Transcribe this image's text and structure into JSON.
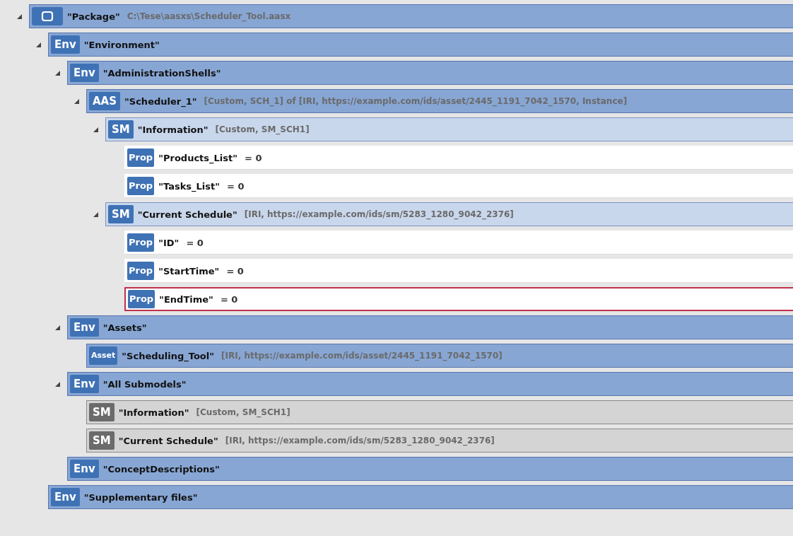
{
  "tree": [
    {
      "kind": "package",
      "name": "\"Package\"",
      "info": "C:\\Tese\\aasxs\\Scheduler_Tool.aasx",
      "expanded": true,
      "selected": false,
      "children": [
        {
          "kind": "env",
          "badge": "Env",
          "name": "\"Environment\"",
          "expanded": true,
          "selected": false,
          "children": [
            {
              "kind": "env",
              "badge": "Env",
              "name": "\"AdministrationShells\"",
              "expanded": true,
              "selected": false,
              "children": [
                {
                  "kind": "aas",
                  "badge": "AAS",
                  "name": "\"Scheduler_1\"",
                  "info": "[Custom, SCH_1] of [IRI, https://example.com/ids/asset/2445_1191_7042_1570, Instance]",
                  "expanded": true,
                  "selected": false,
                  "children": [
                    {
                      "kind": "sm",
                      "badge": "SM",
                      "name": "\"Information\"",
                      "info": "[Custom, SM_SCH1]",
                      "expanded": true,
                      "selected": false,
                      "children": [
                        {
                          "kind": "prop",
                          "badge": "Prop",
                          "name": "\"Products_List\"",
                          "value": "= 0",
                          "selected": false
                        },
                        {
                          "kind": "prop",
                          "badge": "Prop",
                          "name": "\"Tasks_List\"",
                          "value": "= 0",
                          "selected": false
                        }
                      ]
                    },
                    {
                      "kind": "sm",
                      "badge": "SM",
                      "name": "\"Current Schedule\"",
                      "info": "[IRI, https://example.com/ids/sm/5283_1280_9042_2376]",
                      "expanded": true,
                      "selected": false,
                      "children": [
                        {
                          "kind": "prop",
                          "badge": "Prop",
                          "name": "\"ID\"",
                          "value": "= 0",
                          "selected": false
                        },
                        {
                          "kind": "prop",
                          "badge": "Prop",
                          "name": "\"StartTime\"",
                          "value": "= 0",
                          "selected": false
                        },
                        {
                          "kind": "prop",
                          "badge": "Prop",
                          "name": "\"EndTime\"",
                          "value": "= 0",
                          "selected": true
                        }
                      ]
                    }
                  ]
                }
              ]
            },
            {
              "kind": "env",
              "badge": "Env",
              "name": "\"Assets\"",
              "expanded": true,
              "selected": false,
              "children": [
                {
                  "kind": "asset",
                  "badge": "Asset",
                  "name": "\"Scheduling_Tool\"",
                  "info": "[IRI, https://example.com/ids/asset/2445_1191_7042_1570]",
                  "selected": false
                }
              ]
            },
            {
              "kind": "env",
              "badge": "Env",
              "name": "\"All Submodels\"",
              "expanded": true,
              "selected": false,
              "children": [
                {
                  "kind": "smref",
                  "badge": "SM",
                  "name": "\"Information\"",
                  "info": "[Custom, SM_SCH1]",
                  "selected": false
                },
                {
                  "kind": "smref",
                  "badge": "SM",
                  "name": "\"Current Schedule\"",
                  "info": "[IRI, https://example.com/ids/sm/5283_1280_9042_2376]",
                  "selected": false
                }
              ]
            },
            {
              "kind": "env",
              "badge": "Env",
              "name": "\"ConceptDescriptions\"",
              "selected": false
            }
          ]
        },
        {
          "kind": "env",
          "badge": "Env",
          "name": "\"Supplementary files\"",
          "selected": false
        }
      ]
    }
  ]
}
